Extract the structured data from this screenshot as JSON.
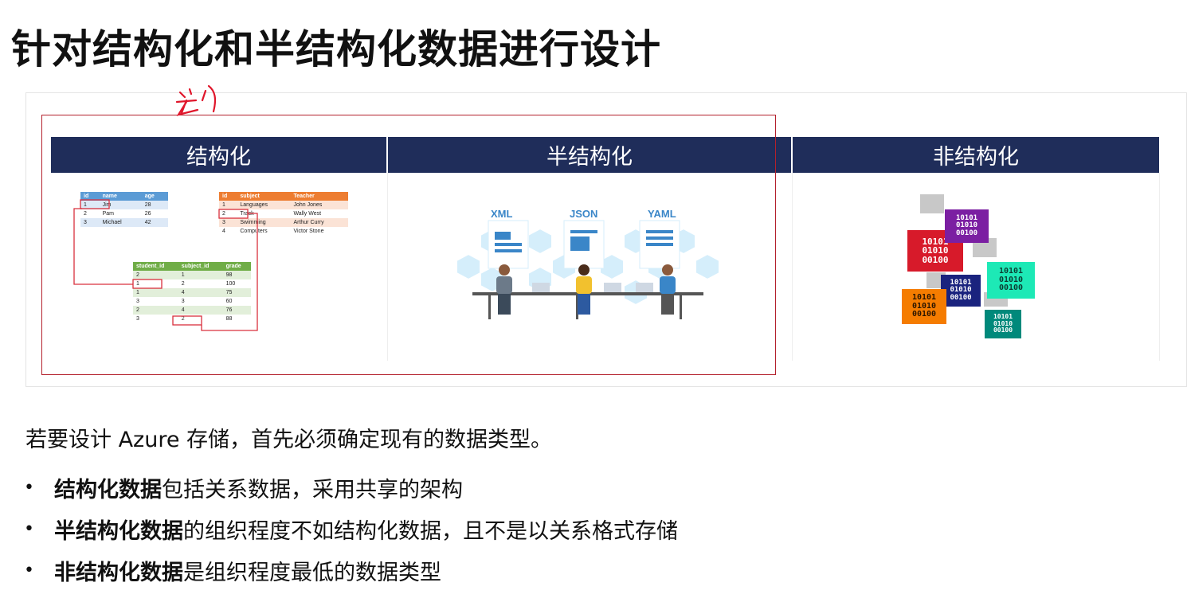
{
  "slide": {
    "title": "针对结构化和半结构化数据进行设计",
    "handwritten_note": "关心",
    "columns": [
      {
        "label": "结构化"
      },
      {
        "label": "半结构化"
      },
      {
        "label": "非结构化"
      }
    ],
    "structured_tables": {
      "students": {
        "headers": [
          "id",
          "name",
          "age"
        ],
        "rows": [
          [
            "1",
            "Jim",
            "28"
          ],
          [
            "2",
            "Pam",
            "26"
          ],
          [
            "3",
            "Michael",
            "42"
          ]
        ]
      },
      "subjects": {
        "headers": [
          "id",
          "subject",
          "Teacher"
        ],
        "rows": [
          [
            "1",
            "Languages",
            "John Jones"
          ],
          [
            "2",
            "Track",
            "Wally West"
          ],
          [
            "3",
            "Swimming",
            "Arthur Curry"
          ],
          [
            "4",
            "Computers",
            "Victor Stone"
          ]
        ]
      },
      "grades": {
        "headers": [
          "student_id",
          "subject_id",
          "grade"
        ],
        "rows": [
          [
            "2",
            "1",
            "98"
          ],
          [
            "1",
            "2",
            "100"
          ],
          [
            "1",
            "4",
            "75"
          ],
          [
            "3",
            "3",
            "60"
          ],
          [
            "2",
            "4",
            "76"
          ],
          [
            "3",
            "2",
            "88"
          ]
        ]
      }
    },
    "semi_structured_formats": [
      "XML",
      "JSON",
      "YAML"
    ],
    "binary_text": [
      "10101",
      "01010",
      "00100"
    ],
    "intro": "若要设计 Azure 存储，首先必须确定现有的数据类型。",
    "bullets": [
      {
        "bold": "结构化数据",
        "rest": "包括关系数据，采用共享的架构"
      },
      {
        "bold": "半结构化数据",
        "rest": "的组织程度不如结构化数据，且不是以关系格式存储"
      },
      {
        "bold": "非结构化数据",
        "rest": "是组织程度最低的数据类型"
      }
    ],
    "colors": {
      "header_bg": "#1f2d5a",
      "highlight_red": "#b3202c",
      "table_blue": "#5b9bd5",
      "table_orange": "#ed7d31",
      "table_green": "#70ad47"
    }
  }
}
